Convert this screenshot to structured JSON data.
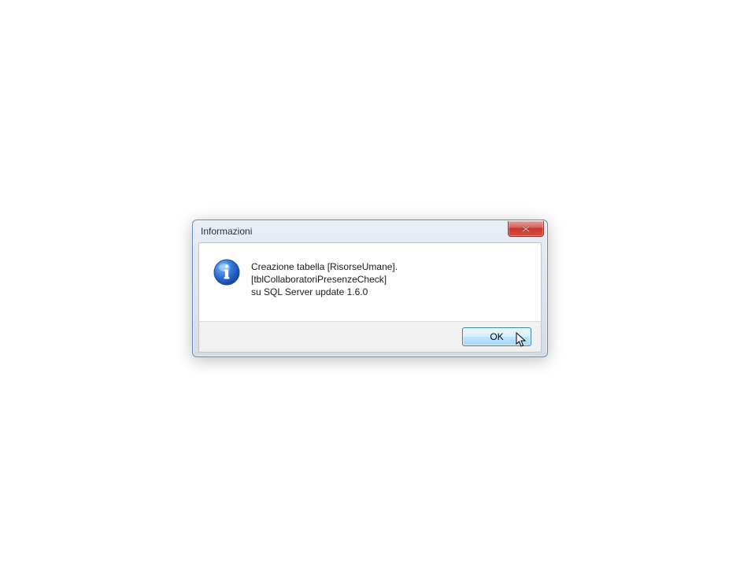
{
  "dialog": {
    "title": "Informazioni",
    "message_line1": "Creazione tabella [RisorseUmane].[tblCollaboratoriPresenzeCheck]",
    "message_line2": "su SQL Server update 1.6.0",
    "ok_label": "OK"
  }
}
